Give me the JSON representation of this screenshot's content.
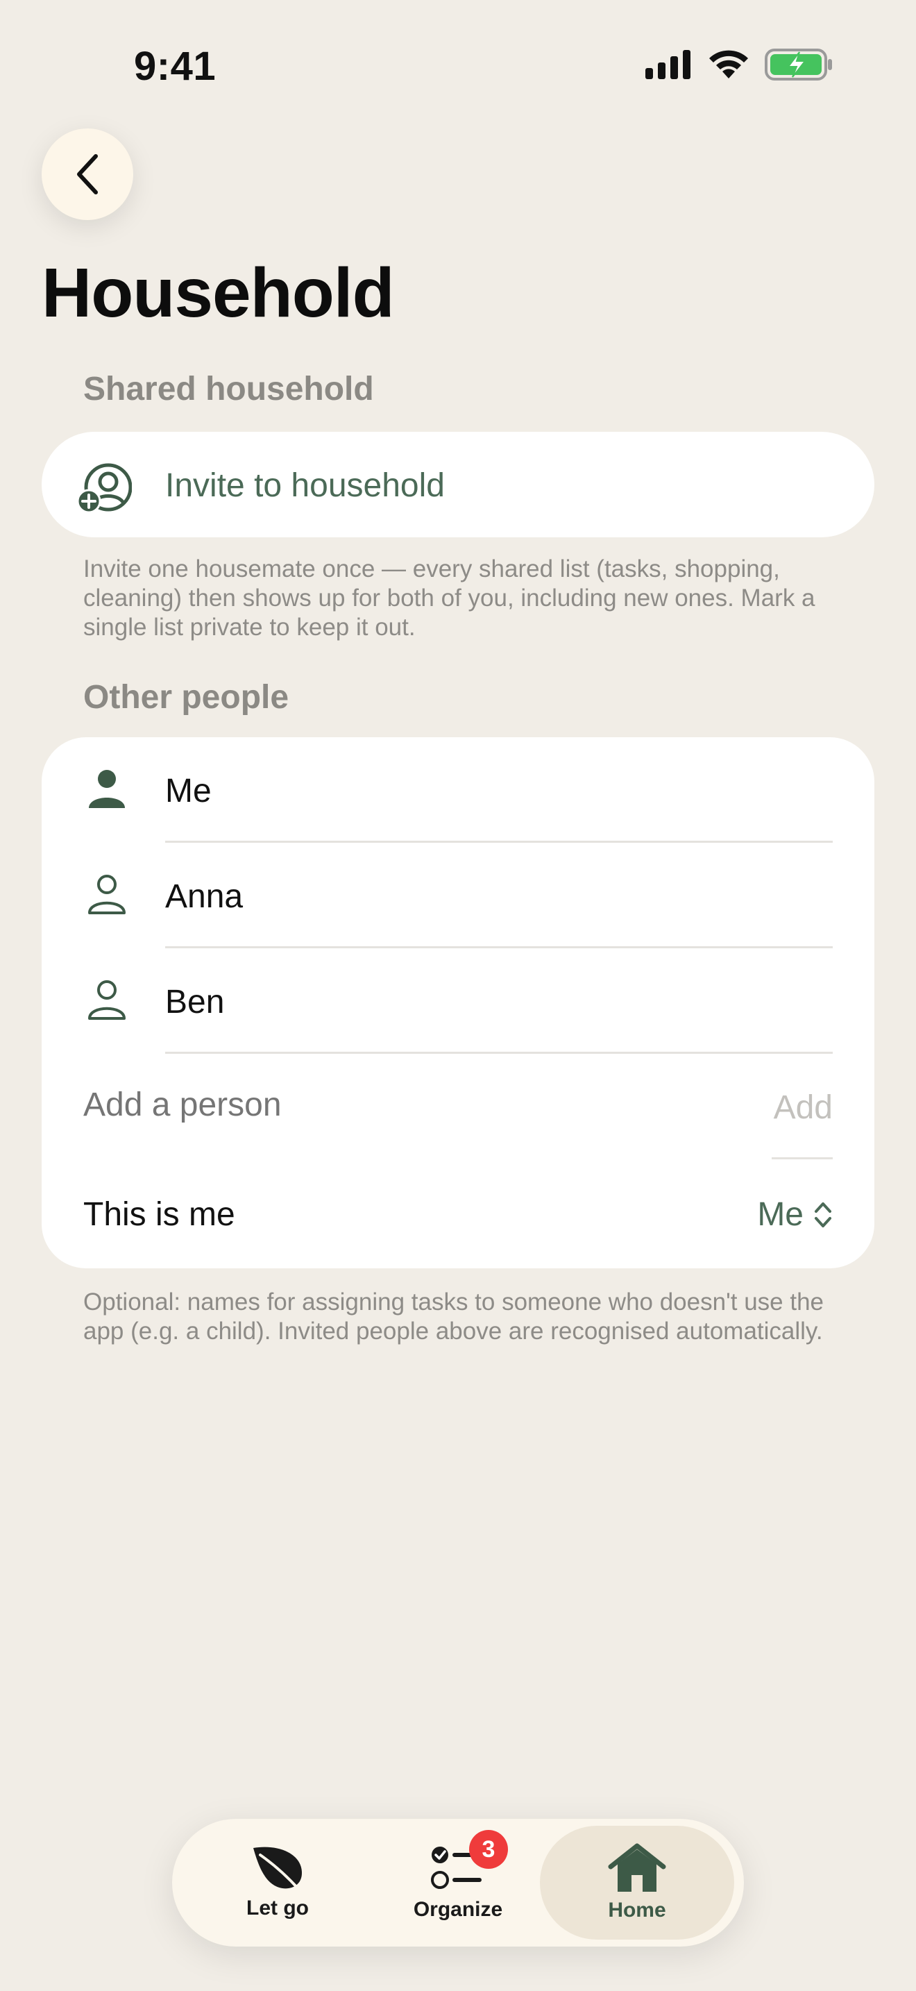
{
  "status_bar": {
    "time": "9:41"
  },
  "header": {
    "title": "Household",
    "back_icon": "chevron-left-icon"
  },
  "shared_household": {
    "section_label": "Shared household",
    "invite_label": "Invite to household",
    "invite_icon": "person-add-icon",
    "help_text": "Invite one housemate once — every shared list (tasks, shopping, cleaning) then shows up for both of you, including new ones. Mark a single list private to keep it out."
  },
  "other_people": {
    "section_label": "Other people",
    "people": [
      {
        "name": "Me",
        "icon": "person-filled-icon"
      },
      {
        "name": "Anna",
        "icon": "person-outline-icon"
      },
      {
        "name": "Ben",
        "icon": "person-outline-icon"
      }
    ],
    "add_placeholder": "Add a person",
    "add_label": "Add",
    "this_is_me_label": "This is me",
    "this_is_me_value": "Me",
    "help_text": "Optional: names for assigning tasks to someone who doesn't use the app (e.g. a child). Invited people above are recognised automatically."
  },
  "tab_bar": {
    "tabs": [
      {
        "label": "Let go",
        "icon": "leaf-icon"
      },
      {
        "label": "Organize",
        "icon": "checklist-icon",
        "badge": "3"
      },
      {
        "label": "Home",
        "icon": "house-icon",
        "active": true
      }
    ]
  },
  "colors": {
    "background": "#F1EDE6",
    "accent": "#4B6A57",
    "badge": "#EF3B3B"
  }
}
